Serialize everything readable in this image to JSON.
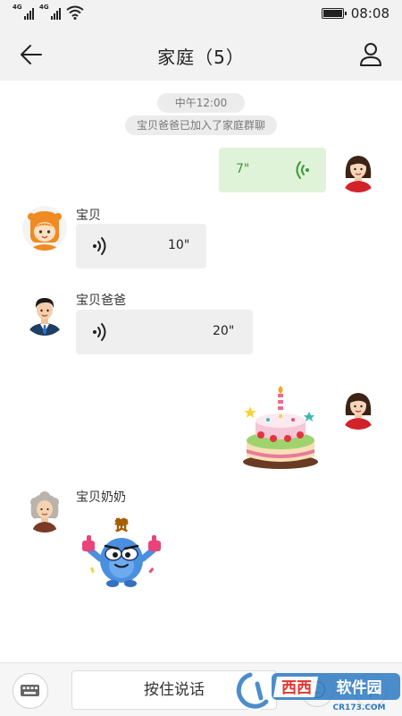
{
  "status_bar": {
    "net1": "4G",
    "net2": "4G",
    "time": "08:08"
  },
  "header": {
    "title": "家庭（5）"
  },
  "chat": {
    "timestamp": "中午12:00",
    "system_notice": "宝贝爸爸已加入了家庭群聊",
    "messages": [
      {
        "sender": "",
        "direction": "out",
        "kind": "voice",
        "duration": "7\""
      },
      {
        "sender": "宝贝",
        "direction": "in",
        "kind": "voice",
        "duration": "10\""
      },
      {
        "sender": "宝贝爸爸",
        "direction": "in",
        "kind": "voice",
        "duration": "20\""
      },
      {
        "sender": "",
        "direction": "out",
        "kind": "sticker",
        "sticker": "birthday-cake"
      },
      {
        "sender": "宝贝奶奶",
        "direction": "in",
        "kind": "sticker",
        "sticker": "thumbs-up-monster",
        "sticker_text": "赞"
      }
    ]
  },
  "input_bar": {
    "hold_to_talk": "按住说话"
  },
  "watermark": {
    "text": "西西软件园",
    "sub": "CR173.COM"
  },
  "colors": {
    "out_bubble": "#dff3d9",
    "in_bubble": "#efefef",
    "voice_green": "#3a9a3a",
    "background": "#ffffff"
  }
}
